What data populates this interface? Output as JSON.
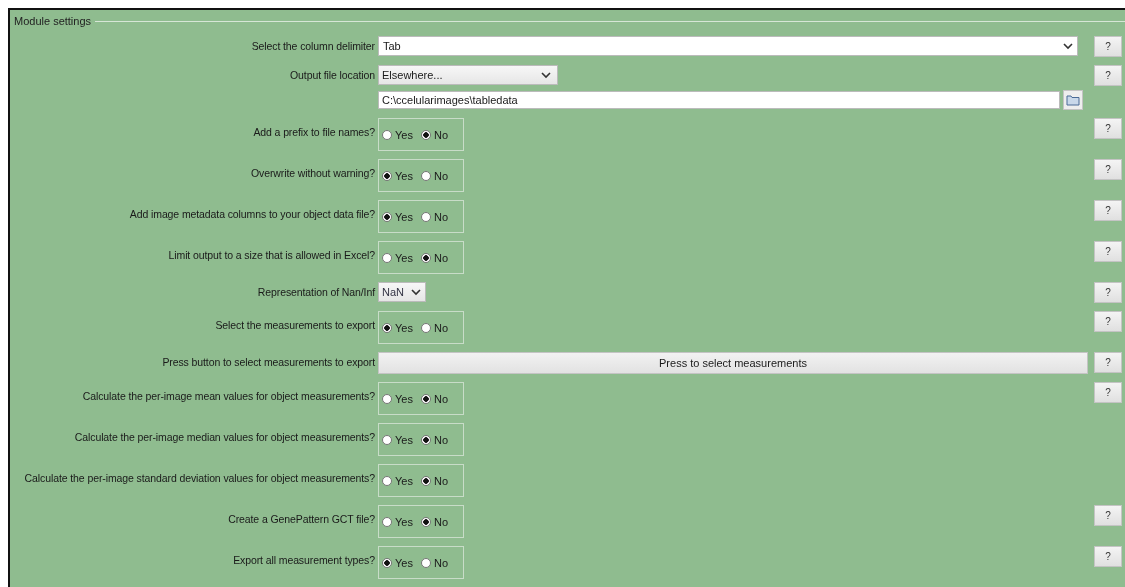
{
  "section": {
    "title": "Module settings"
  },
  "settings": [
    {
      "kind": "combo",
      "label": "Select the column delimiter",
      "value": "Tab",
      "help": "?"
    },
    {
      "kind": "choice",
      "label": "Output file location",
      "value": "Elsewhere...",
      "path": "C:\\ccelularimages\\tabledata",
      "help": "?"
    },
    {
      "kind": "radio",
      "label": "Add a prefix to file names?",
      "options": [
        {
          "label": "Yes",
          "selected": false
        },
        {
          "label": "No",
          "selected": true
        }
      ],
      "help": "?"
    },
    {
      "kind": "radio",
      "label": "Overwrite without warning?",
      "options": [
        {
          "label": "Yes",
          "selected": true
        },
        {
          "label": "No",
          "selected": false
        }
      ],
      "help": "?"
    },
    {
      "kind": "radio",
      "label": "Add image metadata columns to your object data file?",
      "options": [
        {
          "label": "Yes",
          "selected": true
        },
        {
          "label": "No",
          "selected": false
        }
      ],
      "help": "?"
    },
    {
      "kind": "radio",
      "label": "Limit output to a size that is allowed in Excel?",
      "options": [
        {
          "label": "Yes",
          "selected": false
        },
        {
          "label": "No",
          "selected": true
        }
      ],
      "help": "?"
    },
    {
      "kind": "short-choice",
      "label": "Representation of Nan/Inf",
      "value": "NaN",
      "help": "?"
    },
    {
      "kind": "radio",
      "label": "Select the measurements to export",
      "options": [
        {
          "label": "Yes",
          "selected": true
        },
        {
          "label": "No",
          "selected": false
        }
      ],
      "help": "?"
    },
    {
      "kind": "button",
      "label": "Press button to select measurements to export",
      "button": "Press to select measurements",
      "help": "?"
    },
    {
      "kind": "radio",
      "label": "Calculate the per-image mean values for object measurements?",
      "options": [
        {
          "label": "Yes",
          "selected": false
        },
        {
          "label": "No",
          "selected": true
        }
      ],
      "help": "?"
    },
    {
      "kind": "radio",
      "label": "Calculate the per-image median values for object measurements?",
      "options": [
        {
          "label": "Yes",
          "selected": false
        },
        {
          "label": "No",
          "selected": true
        }
      ]
    },
    {
      "kind": "radio",
      "label": "Calculate the per-image standard deviation values for object measurements?",
      "options": [
        {
          "label": "Yes",
          "selected": false
        },
        {
          "label": "No",
          "selected": true
        }
      ]
    },
    {
      "kind": "radio",
      "label": "Create a GenePattern GCT file?",
      "options": [
        {
          "label": "Yes",
          "selected": false
        },
        {
          "label": "No",
          "selected": true
        }
      ],
      "help": "?"
    },
    {
      "kind": "radio",
      "label": "Export all measurement types?",
      "options": [
        {
          "label": "Yes",
          "selected": true
        },
        {
          "label": "No",
          "selected": false
        }
      ],
      "help": "?"
    }
  ]
}
